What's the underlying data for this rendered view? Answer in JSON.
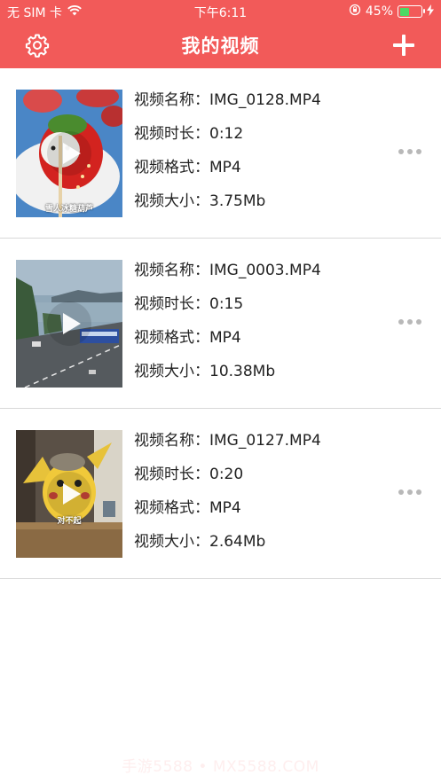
{
  "status_bar": {
    "carrier": "无 SIM 卡",
    "time": "下午6:11",
    "battery": "45%",
    "battery_level": 0.45
  },
  "nav": {
    "title": "我的视频",
    "settings_icon": "gear-icon",
    "add_icon": "plus-icon"
  },
  "labels": {
    "name": "视频名称：",
    "duration": "视频时长：",
    "format": "视频格式：",
    "size": "视频大小："
  },
  "videos": [
    {
      "name": "IMG_0128.MP4",
      "duration": "0:12",
      "format": "MP4",
      "size": "3.75Mb",
      "thumb_caption": "雪人冰糖葫芦"
    },
    {
      "name": "IMG_0003.MP4",
      "duration": "0:15",
      "format": "MP4",
      "size": "10.38Mb",
      "thumb_caption": ""
    },
    {
      "name": "IMG_0127.MP4",
      "duration": "0:20",
      "format": "MP4",
      "size": "2.64Mb",
      "thumb_caption": "对不起"
    }
  ],
  "watermark": "手游5588 • MX5588.COM",
  "colors": {
    "header": "#f25a59",
    "battery": "#4cd964",
    "divider": "#d8d8d8"
  }
}
